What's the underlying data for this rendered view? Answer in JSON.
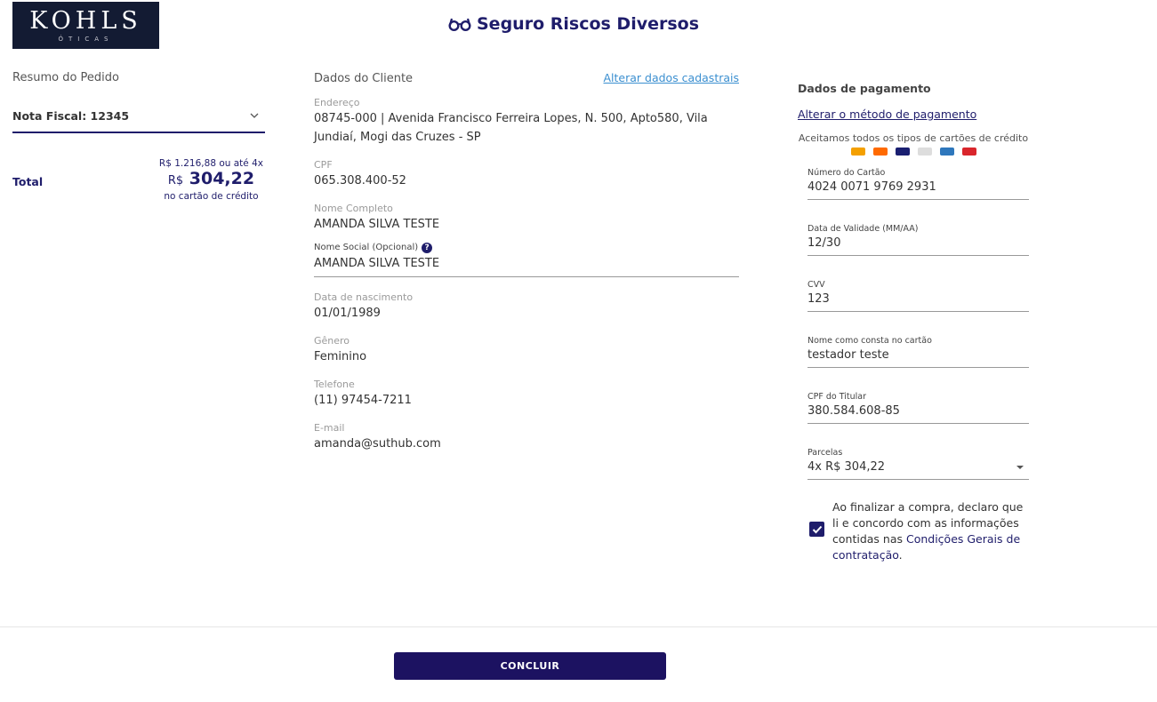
{
  "logo": {
    "brand": "KOHLS",
    "sub": "ÓTICAS"
  },
  "page_title": "Seguro Riscos Diversos",
  "order_summary": {
    "title": "Resumo do Pedido",
    "invoice_label": "Nota Fiscal: 12345",
    "total_label": "Total",
    "total_line1": "R$ 1.216,88 ou até 4x",
    "currency": "R$",
    "installment_value": "304,22",
    "total_line3": "no cartão de crédito"
  },
  "client": {
    "title": "Dados do Cliente",
    "edit_link": "Alterar dados cadastrais",
    "fields": [
      {
        "label": "Endereço",
        "value": "08745-000 | Avenida Francisco Ferreira Lopes, N. 500, Apto580, Vila Jundiaí, Mogi das Cruzes - SP"
      },
      {
        "label": "CPF",
        "value": "065.308.400-52"
      },
      {
        "label": "Nome Completo",
        "value": "AMANDA SILVA TESTE"
      },
      {
        "label": "Nome Social (Opcional)",
        "value": "AMANDA SILVA TESTE"
      },
      {
        "label": "Data de nascimento",
        "value": "01/01/1989"
      },
      {
        "label": "Gênero",
        "value": "Feminino"
      },
      {
        "label": "Telefone",
        "value": "(11) 97454-7211"
      },
      {
        "label": "E-mail",
        "value": "amanda@suthub.com"
      }
    ],
    "help_glyph": "?"
  },
  "payment": {
    "title": "Dados de pagamento",
    "change_link": "Alterar o método de pagamento",
    "cards_note": "Aceitamos todos os tipos de cartões de crédito",
    "card_brands": [
      {
        "name": "mastercard",
        "color": "#f4a000"
      },
      {
        "name": "hipercard",
        "color": "#ff6a00"
      },
      {
        "name": "visa",
        "color": "#1a1f71"
      },
      {
        "name": "elo",
        "color": "#cccccc"
      },
      {
        "name": "amex",
        "color": "#2e77bc"
      },
      {
        "name": "diners",
        "color": "#d9262c"
      }
    ],
    "fields": [
      {
        "label": "Número do Cartão",
        "value": "4024 0071 9769 2931"
      },
      {
        "label": "Data de Validade (MM/AA)",
        "value": "12/30"
      },
      {
        "label": "CVV",
        "value": "123"
      },
      {
        "label": "Nome como consta no cartão",
        "value": "testador teste"
      },
      {
        "label": "CPF do Titular",
        "value": "380.584.608-85"
      }
    ],
    "installments": {
      "label": "Parcelas",
      "value": "4x R$ 304,22"
    },
    "terms_text": "Ao finalizar a compra, declaro que li e concordo com as informações contidas nas ",
    "terms_link": "Condições Gerais de contratação",
    "terms_end": ".",
    "terms_checked": true
  },
  "submit_label": "CONCLUIR",
  "colors": {
    "primary": "#1f1d6b",
    "button": "#1c1261",
    "link": "#3b8fd0"
  }
}
